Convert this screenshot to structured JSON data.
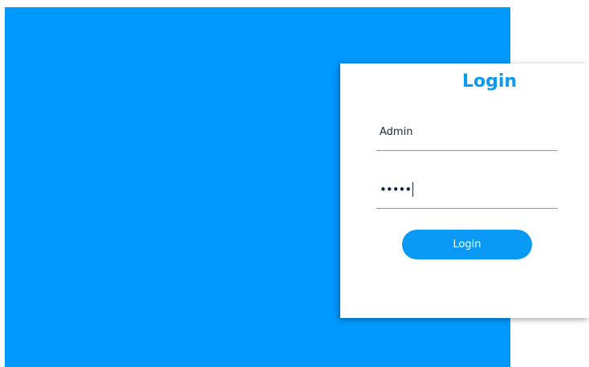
{
  "login_card": {
    "title": "Login",
    "username": {
      "value": "Admin"
    },
    "password": {
      "masked_value": "•••••"
    },
    "submit_label": "Login"
  },
  "colors": {
    "background_panel": "#0099ff",
    "accent": "#0a9af0",
    "card": "#ffffff",
    "input_underline": "#9a9a9a"
  }
}
